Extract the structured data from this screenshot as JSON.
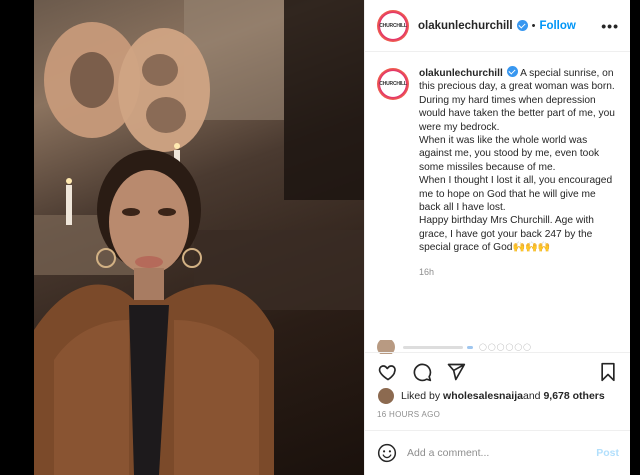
{
  "header": {
    "avatar_text": "CHURCHILL",
    "username": "olakunlechurchill",
    "separator": "•",
    "follow_label": "Follow",
    "more_label": "•••"
  },
  "caption": {
    "username": "olakunlechurchill",
    "text": " A special sunrise, on this precious day, a great woman was born.\nDuring my hard times when depression would have taken the better part of me, you were my bedrock.\nWhen it was like the whole world was against me, you stood by me, even took some missiles because of me.\nWhen I thought I lost it all, you encouraged me to hope on God that he will give me back all I have lost.\nHappy birthday Mrs Churchill. Age with grace, I have got your back 247 by the special grace of God🙌🙌🙌",
    "time": "16h"
  },
  "actions": {
    "like_icon": "heart-icon",
    "comment_icon": "comment-icon",
    "share_icon": "share-icon",
    "save_icon": "bookmark-icon"
  },
  "likes": {
    "prefix": "Liked by ",
    "user": "wholesalesnaija",
    "suffix": " and ",
    "count": "9,678 others"
  },
  "timestamp": "16 HOURS AGO",
  "comment": {
    "placeholder": "Add a comment...",
    "post_label": "Post"
  },
  "colors": {
    "accent": "#0095f6",
    "verified": "#3897f0",
    "post_disabled": "#b2dffc",
    "muted": "#8e8e8e"
  }
}
